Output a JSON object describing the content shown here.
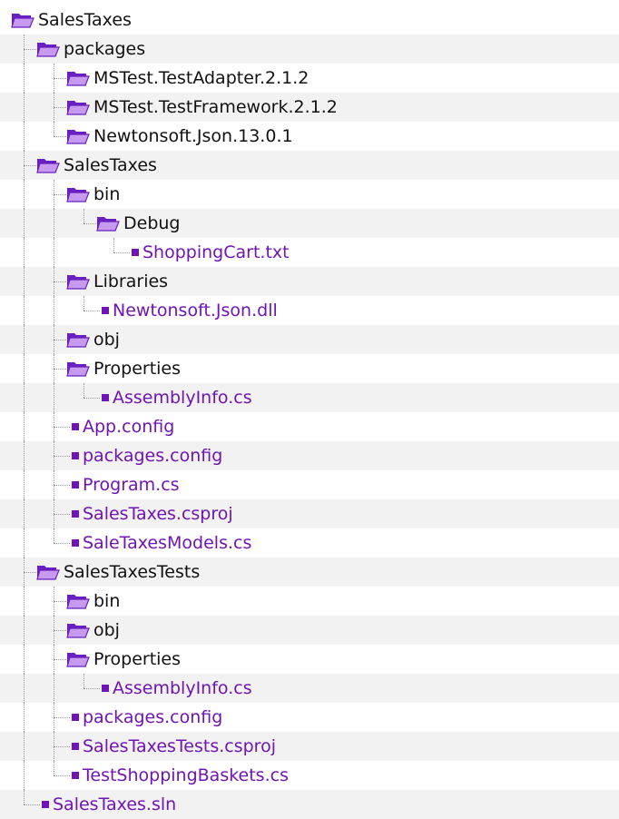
{
  "tree": {
    "items": [
      {
        "label": "SalesTaxes",
        "type": "folder",
        "depth": 0,
        "last": true
      },
      {
        "label": "packages",
        "type": "folder",
        "depth": 1,
        "last": false
      },
      {
        "label": "MSTest.TestAdapter.2.1.2",
        "type": "folder",
        "depth": 2,
        "last": false
      },
      {
        "label": "MSTest.TestFramework.2.1.2",
        "type": "folder",
        "depth": 2,
        "last": false
      },
      {
        "label": "Newtonsoft.Json.13.0.1",
        "type": "folder",
        "depth": 2,
        "last": true
      },
      {
        "label": "SalesTaxes",
        "type": "folder",
        "depth": 1,
        "last": false
      },
      {
        "label": "bin",
        "type": "folder",
        "depth": 2,
        "last": false
      },
      {
        "label": "Debug",
        "type": "folder",
        "depth": 3,
        "last": true
      },
      {
        "label": "ShoppingCart.txt",
        "type": "file",
        "depth": 4,
        "last": true
      },
      {
        "label": "Libraries",
        "type": "folder",
        "depth": 2,
        "last": false
      },
      {
        "label": "Newtonsoft.Json.dll",
        "type": "file",
        "depth": 3,
        "last": true
      },
      {
        "label": "obj",
        "type": "folder",
        "depth": 2,
        "last": false
      },
      {
        "label": "Properties",
        "type": "folder",
        "depth": 2,
        "last": false
      },
      {
        "label": "AssemblyInfo.cs",
        "type": "file",
        "depth": 3,
        "last": true
      },
      {
        "label": "App.config",
        "type": "file",
        "depth": 2,
        "last": false
      },
      {
        "label": "packages.config",
        "type": "file",
        "depth": 2,
        "last": false
      },
      {
        "label": "Program.cs",
        "type": "file",
        "depth": 2,
        "last": false
      },
      {
        "label": "SalesTaxes.csproj",
        "type": "file",
        "depth": 2,
        "last": false
      },
      {
        "label": "SaleTaxesModels.cs",
        "type": "file",
        "depth": 2,
        "last": true
      },
      {
        "label": "SalesTaxesTests",
        "type": "folder",
        "depth": 1,
        "last": false
      },
      {
        "label": "bin",
        "type": "folder",
        "depth": 2,
        "last": false
      },
      {
        "label": "obj",
        "type": "folder",
        "depth": 2,
        "last": false
      },
      {
        "label": "Properties",
        "type": "folder",
        "depth": 2,
        "last": false
      },
      {
        "label": "AssemblyInfo.cs",
        "type": "file",
        "depth": 3,
        "last": true
      },
      {
        "label": "packages.config",
        "type": "file",
        "depth": 2,
        "last": false
      },
      {
        "label": "SalesTaxesTests.csproj",
        "type": "file",
        "depth": 2,
        "last": false
      },
      {
        "label": "TestShoppingBaskets.cs",
        "type": "file",
        "depth": 2,
        "last": true
      },
      {
        "label": "SalesTaxes.sln",
        "type": "file",
        "depth": 1,
        "last": true
      }
    ]
  },
  "colors": {
    "file_text": "#7014b5",
    "file_icon": "#7014b5",
    "folder_text": "#111111",
    "folder_icon_back": "#6a1fc0",
    "folder_icon_front": "#c79af0",
    "guide_line": "#9a9a9a",
    "alt_row": "#f2f2f2"
  },
  "icons": {
    "folder": "folder-open-icon",
    "file": "file-icon"
  }
}
